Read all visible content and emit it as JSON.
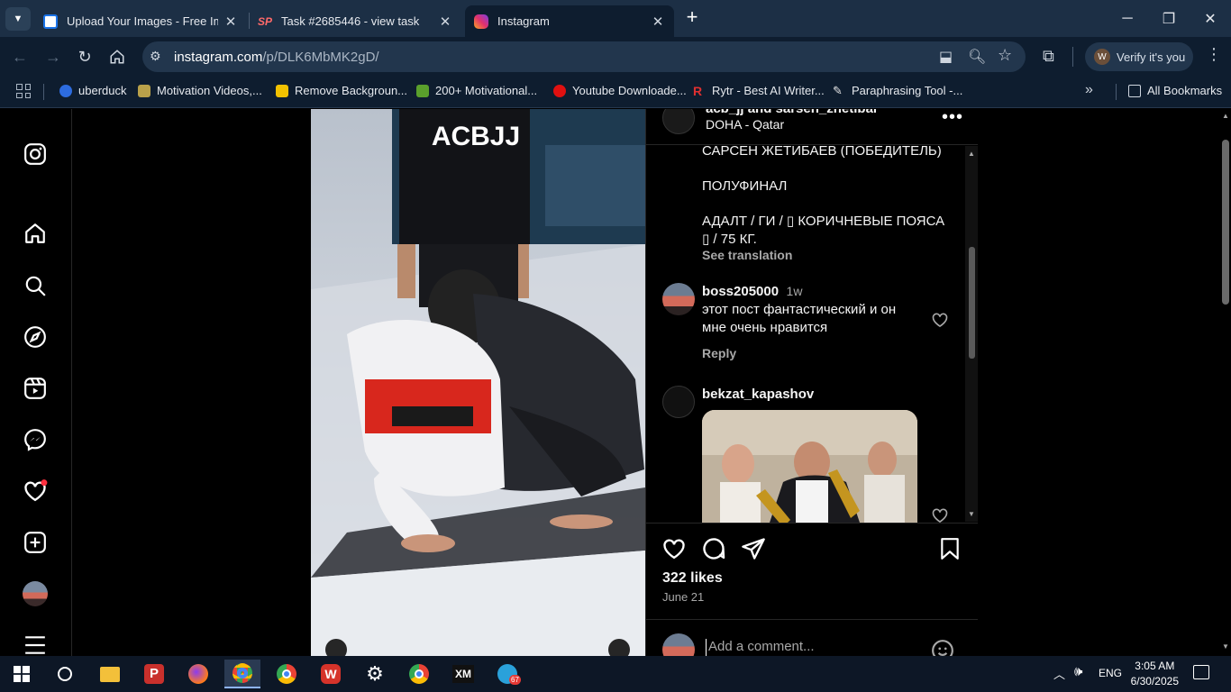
{
  "browser": {
    "tabs": [
      {
        "title": "Upload Your Images - Free Ima",
        "icon": "image-upload-icon",
        "color": "#ffffff"
      },
      {
        "title": "Task #2685446 - view task",
        "icon": "sp-logo-icon",
        "color": "#ff6a6a"
      },
      {
        "title": "Instagram",
        "icon": "instagram-icon",
        "color": "#e1306c"
      }
    ],
    "url_host": "instagram.com",
    "url_path": "/p/DLK6MbMK2gD/",
    "verify_label": "Verify it's you",
    "bookmarks": [
      {
        "label": "uberduck",
        "color": "#2d6cdf"
      },
      {
        "label": "Motivation Videos,...",
        "color": "#b9a14a"
      },
      {
        "label": "Remove Backgroun...",
        "color": "#f2c200"
      },
      {
        "label": "200+ Motivational...",
        "color": "#5aa02c"
      },
      {
        "label": "Youtube Downloade...",
        "color": "#e01010"
      },
      {
        "label": "Rytr - Best AI Writer...",
        "color": "#e03030"
      },
      {
        "label": "Paraphrasing Tool -...",
        "color": "#e8e8e8"
      }
    ],
    "all_bookmarks": "All Bookmarks"
  },
  "post": {
    "video_logo": "ACBJJ",
    "header": {
      "users": "acb_jj and sarsen_zhetibai",
      "location": "DOHA - Qatar"
    },
    "caption_lines": [
      "САРСЕН ЖЕТИБАЕВ (ПОБЕДИТЕЛЬ)",
      "ПОЛУФИНАЛ",
      "АДАЛТ / ГИ / ▯ КОРИЧНЕВЫЕ ПОЯСА",
      "▯ / 75 КГ."
    ],
    "see_translation": "See translation",
    "comments": [
      {
        "user": "boss205000",
        "time": "1w",
        "text_line1": "этот пост фантастический и он",
        "text_line2": "мне очень нравится",
        "reply": "Reply"
      },
      {
        "user": "bekzat_kapashov"
      }
    ],
    "likes": "322 likes",
    "date": "June 21",
    "comment_placeholder": "Add a comment..."
  },
  "taskbar": {
    "lang": "ENG",
    "time": "3:05 AM",
    "date": "6/30/2025",
    "telegram_badge": "67"
  }
}
